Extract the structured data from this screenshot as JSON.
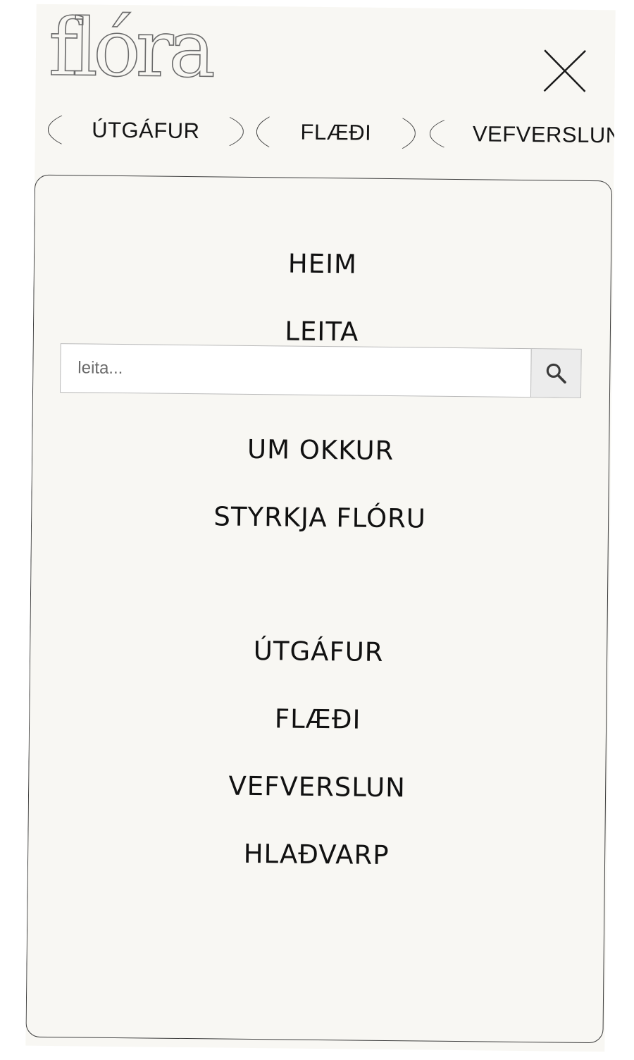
{
  "brand": {
    "logo_text": "flóra"
  },
  "header": {
    "close_icon": "close-icon"
  },
  "pill_tabs": [
    {
      "label": "ÚTGÁFUR"
    },
    {
      "label": "FLÆÐI"
    },
    {
      "label": "VEFVERSLUN"
    }
  ],
  "menu": {
    "primary": [
      {
        "label": "HEIM"
      },
      {
        "label": "LEITA"
      }
    ],
    "search": {
      "placeholder": "leita...",
      "value": "",
      "button_icon": "search-icon"
    },
    "secondary": [
      {
        "label": "UM OKKUR"
      },
      {
        "label": "STYRKJA FLÓRU"
      }
    ],
    "sections": [
      {
        "label": "ÚTGÁFUR"
      },
      {
        "label": "FLÆÐI"
      },
      {
        "label": "VEFVERSLUN"
      },
      {
        "label": "HLAÐVARP"
      }
    ]
  },
  "colors": {
    "background": "#f8f7f3",
    "text": "#111111",
    "border": "#3c3c3c",
    "search_button_bg": "#ececec"
  }
}
